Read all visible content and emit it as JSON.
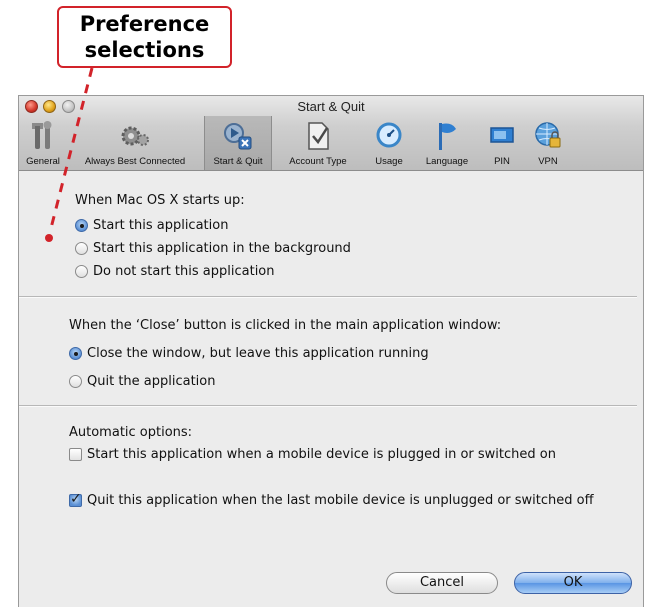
{
  "callout": {
    "line1": "Preference",
    "line2": "selections"
  },
  "window": {
    "title": "Start & Quit"
  },
  "toolbar": {
    "items": [
      {
        "label": "General",
        "icon": "tools-icon"
      },
      {
        "label": "Always Best Connected",
        "icon": "gears-icon"
      },
      {
        "label": "Start & Quit",
        "icon": "start-quit-icon",
        "selected": true
      },
      {
        "label": "Account Type",
        "icon": "document-icon"
      },
      {
        "label": "Usage",
        "icon": "gauge-icon"
      },
      {
        "label": "Language",
        "icon": "flag-icon"
      },
      {
        "label": "PIN",
        "icon": "sim-icon"
      },
      {
        "label": "VPN",
        "icon": "globe-lock-icon"
      }
    ]
  },
  "startup": {
    "heading": "When Mac OS X starts up:",
    "options": [
      "Start this application",
      "Start this application in the background",
      "Do not start this application"
    ],
    "selected": 0
  },
  "close": {
    "heading": "When the ‘Close’ button is clicked in the main application window:",
    "options": [
      "Close the window, but leave this application running",
      "Quit the application"
    ],
    "selected": 0
  },
  "automatic": {
    "heading": "Automatic options:",
    "options": [
      {
        "label": "Start this application when a mobile device is plugged in or switched on",
        "checked": false
      },
      {
        "label": "Quit this application when the last mobile device is unplugged or switched off",
        "checked": true
      }
    ]
  },
  "buttons": {
    "cancel": "Cancel",
    "ok": "OK"
  },
  "colors": {
    "callout_red": "#d2232a",
    "default_button_blue": "#5a95e3"
  }
}
